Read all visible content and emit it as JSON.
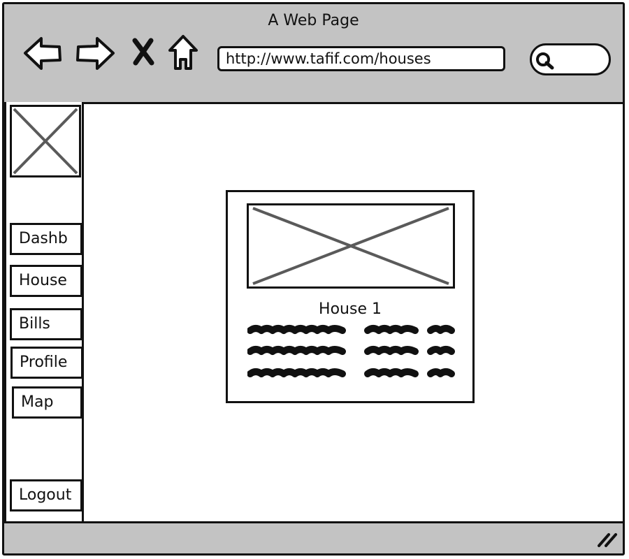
{
  "window": {
    "title": "A Web Page"
  },
  "browser": {
    "url": "http://www.tafif.com/houses",
    "nav_icons": [
      "back-arrow-icon",
      "forward-arrow-icon",
      "close-x-icon",
      "home-icon"
    ],
    "search_icon": "magnifier-icon"
  },
  "sidebar": {
    "logo": "image-placeholder-icon",
    "items": [
      {
        "label": "Dashb"
      },
      {
        "label": "House"
      },
      {
        "label": "Bills"
      },
      {
        "label": "Profile"
      },
      {
        "label": "Map"
      }
    ],
    "logout": {
      "label": "Logout"
    }
  },
  "main": {
    "card": {
      "image": "image-placeholder-icon",
      "title": "House 1",
      "placeholder_text": "scribble-lines"
    }
  },
  "colors": {
    "chrome": "#c3c3c3",
    "ink": "#111111",
    "placeholder_cross": "#5a5a5a"
  }
}
